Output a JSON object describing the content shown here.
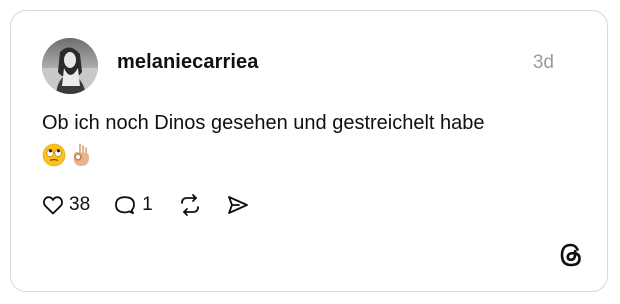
{
  "post": {
    "username": "melaniecarriea",
    "time": "3d",
    "text": "Ob ich noch Dinos gesehen und gestreichelt habe",
    "emojis": [
      "face-with-rolling-eyes-emoji",
      "ok-hand-emoji"
    ]
  },
  "actions": {
    "likes": "38",
    "replies": "1"
  },
  "icons": {
    "like": "heart-icon",
    "reply": "comment-icon",
    "repost": "repost-icon",
    "share": "send-icon",
    "logo": "threads-logo-icon"
  },
  "colors": {
    "text": "#101010",
    "muted": "#9a9a9a",
    "border": "#d9d9d9"
  }
}
